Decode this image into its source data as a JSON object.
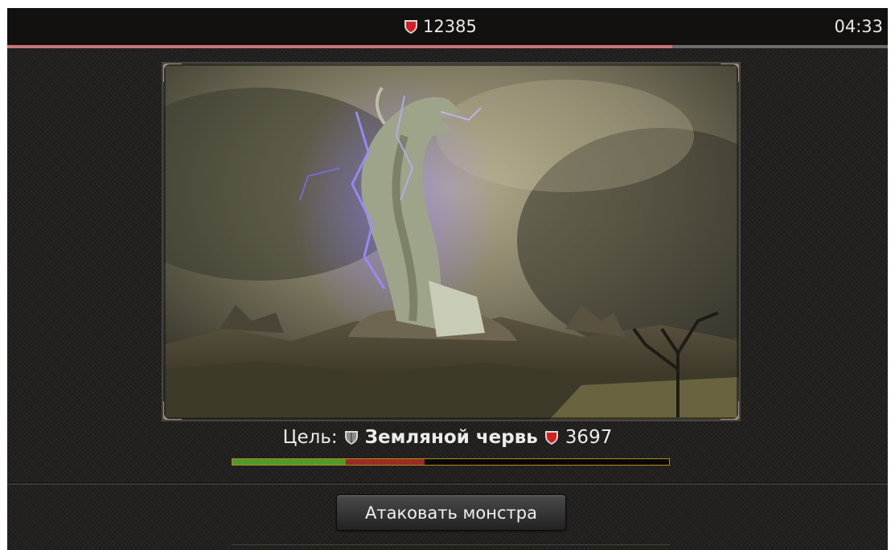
{
  "header": {
    "total_hp": "12385",
    "timer": "04:33",
    "time_progress_fraction": 0.755
  },
  "target": {
    "label": "Цель:",
    "name": "Земляной червь",
    "hp": "3697",
    "hp_bar": {
      "green_fraction": 0.26,
      "red_fraction": 0.18
    }
  },
  "actions": {
    "attack_label": "Атаковать монстра"
  },
  "colors": {
    "progress": "#c97478",
    "hp_green": "#4e9a2c",
    "hp_red": "#9a2c24",
    "hp_border": "#b08a1c",
    "hp_icon": "#d42020",
    "armor_icon": "#9a9a9a"
  },
  "icons": {
    "hp": "red-shield-icon",
    "armor": "gray-shield-icon"
  }
}
